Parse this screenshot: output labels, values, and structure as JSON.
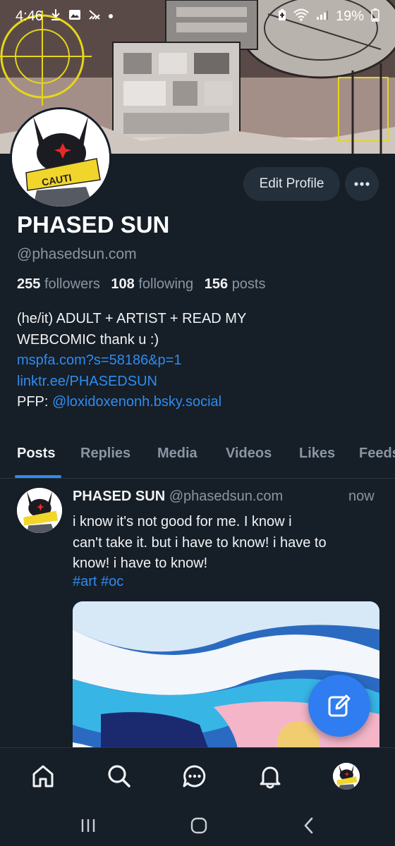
{
  "status_bar": {
    "time": "4:46",
    "battery": "19%",
    "icons": [
      "download-icon",
      "image-icon",
      "signal-slash-icon",
      "dot-icon",
      "battery-saver-icon",
      "wifi-icon",
      "cell-signal-icon",
      "battery-icon"
    ]
  },
  "profile": {
    "edit_label": "Edit Profile",
    "more_label": "•••",
    "display_name": "PHASED SUN",
    "handle": "@phasedsun.com",
    "followers_count": "255",
    "followers_label": "followers",
    "following_count": "108",
    "following_label": "following",
    "posts_count": "156",
    "posts_label": "posts",
    "bio_line1": "(he/it) ADULT + ARTIST + READ MY",
    "bio_line2": "WEBCOMIC thank u :)",
    "link1": "mspfa.com?s=58186&p=1",
    "link2": "linktr.ee/PHASEDSUN",
    "pfp_prefix": "PFP: ",
    "pfp_link": "@loxidoxenonh.bsky.social",
    "avatar_text": "CAUTI"
  },
  "tabs": [
    "Posts",
    "Replies",
    "Media",
    "Videos",
    "Likes",
    "Feeds"
  ],
  "active_tab": "Posts",
  "post": {
    "author": "PHASED SUN",
    "handle": "@phasedsun.com",
    "time": "now",
    "text_line1": "i know it's not good for me. I know i",
    "text_line2": "can't take it. but i have to know! i have to",
    "text_line3": "know! i have to know!",
    "tags": "#art #oc"
  },
  "bottom_nav": [
    "home-icon",
    "search-icon",
    "chat-icon",
    "bell-icon",
    "profile-avatar"
  ],
  "colors": {
    "background": "#161e27",
    "accent": "#2f8cf0",
    "muted": "#8996a3",
    "button_bg": "#232f3b"
  }
}
